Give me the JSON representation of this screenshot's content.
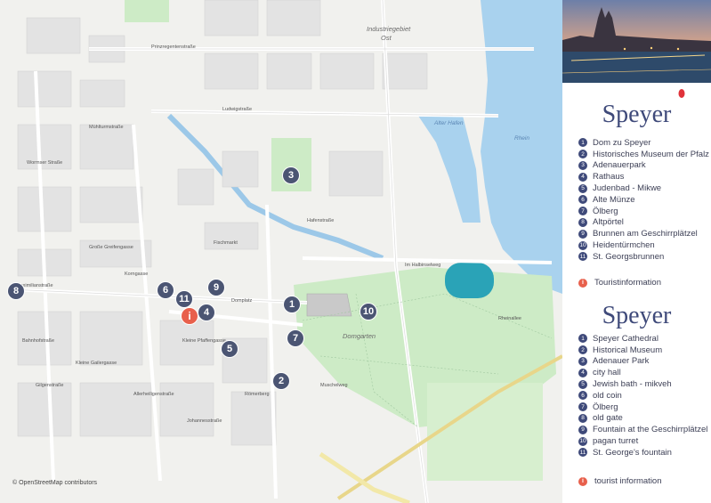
{
  "panel": {
    "title_de": "Speyer",
    "title_en": "Speyer",
    "legend_de": [
      {
        "num": "1",
        "label": "Dom zu Speyer"
      },
      {
        "num": "2",
        "label": "Historisches Museum der Pfalz"
      },
      {
        "num": "3",
        "label": "Adenauerpark"
      },
      {
        "num": "4",
        "label": "Rathaus"
      },
      {
        "num": "5",
        "label": "Judenbad - Mikwe"
      },
      {
        "num": "6",
        "label": "Alte Münze"
      },
      {
        "num": "7",
        "label": "Ölberg"
      },
      {
        "num": "8",
        "label": "Altpörtel"
      },
      {
        "num": "9",
        "label": "Brunnen am Geschirrplätzel"
      },
      {
        "num": "10",
        "label": "Heidentürmchen"
      },
      {
        "num": "11",
        "label": "St. Georgsbrunnen"
      }
    ],
    "tourist_de": "Touristinformation",
    "legend_en": [
      {
        "num": "1",
        "label": "Speyer Cathedral"
      },
      {
        "num": "2",
        "label": "Historical Museum"
      },
      {
        "num": "3",
        "label": "Adenauer Park"
      },
      {
        "num": "4",
        "label": "city hall"
      },
      {
        "num": "5",
        "label": "Jewish bath - mikveh"
      },
      {
        "num": "6",
        "label": "old coin"
      },
      {
        "num": "7",
        "label": "Ölberg"
      },
      {
        "num": "8",
        "label": "old gate"
      },
      {
        "num": "9",
        "label": "Fountain at the Geschirrplätzel"
      },
      {
        "num": "10",
        "label": "pagan turret"
      },
      {
        "num": "11",
        "label": "St. George's fountain"
      }
    ],
    "tourist_en": "tourist information",
    "info_symbol": "i",
    "colors": {
      "accent": "#3f4a7a",
      "info": "#e8604c",
      "water": "#a9d2ee",
      "park": "#cdebc6"
    }
  },
  "map": {
    "markers": [
      "1",
      "2",
      "3",
      "4",
      "5",
      "6",
      "7",
      "8",
      "9",
      "10",
      "11"
    ],
    "info_symbol": "i",
    "attribution": "© OpenStreetMap contributors",
    "places": {
      "industrial": "Industriegebiet",
      "industrial2": "Ost",
      "altrhein": "Alter Hafen",
      "domgarten": "Domgarten",
      "rhein": "Rhein"
    },
    "streets": {
      "maximilianstrasse": "Maximilianstraße",
      "prinzregent": "Prinzregentenstraße",
      "ludwigstrasse": "Ludwigstraße",
      "mühlturm": "Mühlturmstraße",
      "hafenstrasse": "Hafenstraße",
      "grosse_greifen": "Große Greifengasse",
      "korngasse": "Korngasse",
      "gilgenstrasse": "Gilgenstraße",
      "kleine_pfaffen": "Kleine Pfaffengasse",
      "johannes": "Johannesstraße",
      "allerheiligen": "Allerheiligenstraße",
      "bahnhofstrasse": "Bahnhofstraße",
      "domplatz": "Domplatz",
      "rheinallee": "Rheinallee",
      "kleine_gailergasse": "Kleine Gailergasse",
      "fischmarkt": "Fischmarkt",
      "wormser": "Wormser Straße",
      "halbinsel": "Im Halbinselweg",
      "roemer": "Römerberg",
      "muschel": "Muschelweg"
    }
  }
}
